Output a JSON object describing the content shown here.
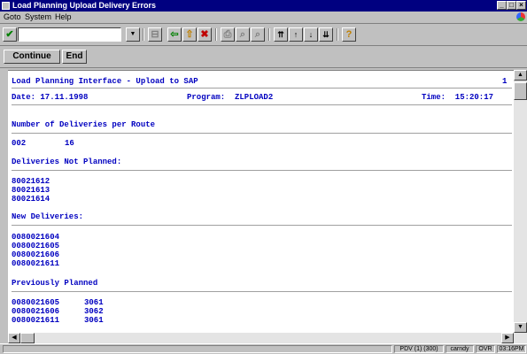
{
  "window": {
    "title": "Load Planning Upload Delivery Errors",
    "controls": {
      "minimize": "_",
      "maximize": "□",
      "close": "×"
    }
  },
  "menu": [
    "Goto",
    "System",
    "Help"
  ],
  "toolbar": {
    "command_value": "",
    "icons": [
      "check-icon",
      "dropdown-icon",
      "save-icon",
      "back-icon",
      "exit-icon",
      "cancel-icon",
      "print-icon",
      "find-icon",
      "find-next-icon",
      "first-page-icon",
      "previous-page-icon",
      "next-page-icon",
      "last-page-icon",
      "help-icon"
    ]
  },
  "buttons": {
    "continue": "Continue",
    "end": "End"
  },
  "report": {
    "header": "Load Planning Interface - Upload to SAP",
    "page": "1",
    "date_label": "Date: 17.11.1998",
    "program_label": "Program:  ZLPLOAD2",
    "time_label": "Time:  15:20:17",
    "routes_title": "Number of Deliveries per Route",
    "route": {
      "code": "002",
      "count": "16"
    },
    "not_planned_title": "Deliveries Not Planned:",
    "not_planned": [
      "80021612",
      "80021613",
      "80021614"
    ],
    "new_title": "New Deliveries:",
    "new": [
      "0080021604",
      "0080021605",
      "0080021606",
      "0080021611"
    ],
    "prev_title": "Previously Planned",
    "prev": [
      {
        "delivery": "0080021605",
        "load": "3061"
      },
      {
        "delivery": "0080021606",
        "load": "3062"
      },
      {
        "delivery": "0080021611",
        "load": "3061"
      }
    ]
  },
  "status": {
    "session": "PDV (1) (300)",
    "user": "carndy",
    "mode": "OVR",
    "time": "03:16PM"
  },
  "colors": {
    "titlebar": "#000080",
    "report_text": "#0000c0",
    "chrome": "#c0c0c0"
  }
}
